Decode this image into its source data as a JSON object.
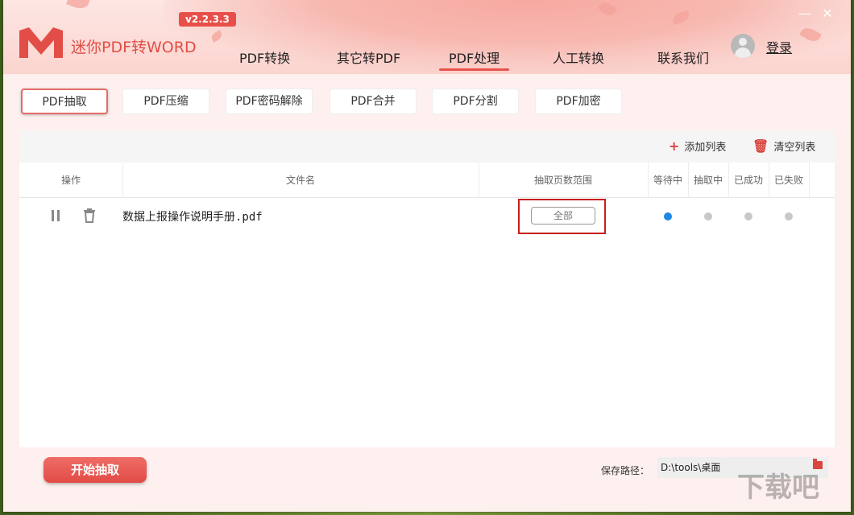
{
  "app": {
    "title": "迷你PDF转WORD",
    "version": "v2.2.3.3"
  },
  "nav": {
    "items": [
      "PDF转换",
      "其它转PDF",
      "PDF处理",
      "人工转换",
      "联系我们"
    ],
    "active": "PDF处理",
    "login": "登录"
  },
  "subtabs": {
    "items": [
      "PDF抽取",
      "PDF压缩",
      "PDF密码解除",
      "PDF合并",
      "PDF分割",
      "PDF加密"
    ],
    "active": "PDF抽取"
  },
  "toolbar": {
    "add_list": "添加列表",
    "clear_list": "清空列表"
  },
  "table": {
    "headers": {
      "op": "操作",
      "filename": "文件名",
      "range": "抽取页数范围",
      "waiting": "等待中",
      "extracting": "抽取中",
      "success": "已成功",
      "failed": "已失败"
    },
    "rows": [
      {
        "filename": "数据上报操作说明手册.pdf",
        "range": "全部",
        "status": "等待中"
      }
    ]
  },
  "footer": {
    "start_button": "开始抽取",
    "save_label": "保存路径：",
    "save_path": "D:\\tools\\桌面"
  },
  "icons": [
    "logo-m-icon",
    "user-icon",
    "minimize-icon",
    "close-icon",
    "plus-icon",
    "trash-icon",
    "pause-icon",
    "folder-icon"
  ],
  "colors": {
    "accent": "#e24e47",
    "active_dot": "#1e88e5",
    "highlight_box": "#c81e1e"
  },
  "watermark": "下载吧"
}
